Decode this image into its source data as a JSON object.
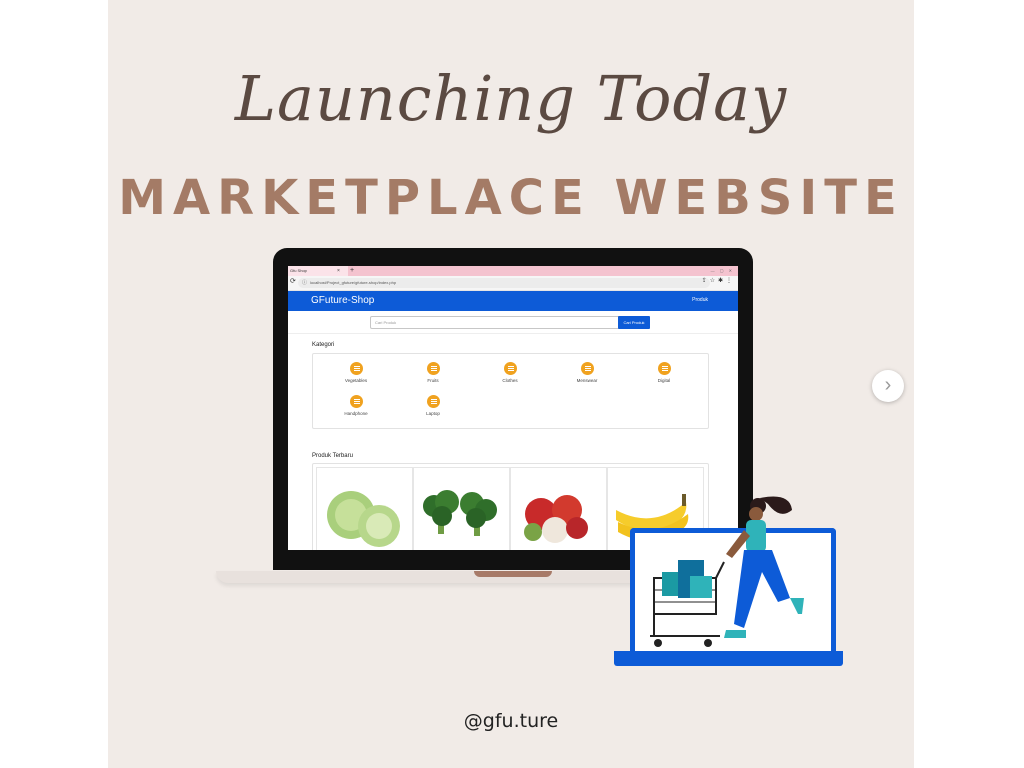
{
  "poster": {
    "script_title": "Launching Today",
    "main_title": "MARKETPLACE WEBSITE",
    "handle": "@gfu.ture"
  },
  "browser": {
    "tab_title": "Gfu Shop",
    "url": "localhost/Project_gfuture/gfuture-shop/index.php",
    "icons": [
      "reload-icon",
      "lock-icon",
      "share-icon",
      "star-icon",
      "extension-icon",
      "menu-icon"
    ]
  },
  "site": {
    "brand": "GFuture-Shop",
    "nav_link": "Produk",
    "search": {
      "placeholder": "Cari Produk",
      "button_label": "Cari Produk"
    },
    "kategori": {
      "title": "Kategori",
      "items": [
        {
          "label": "Vegetables",
          "icon": "list-icon"
        },
        {
          "label": "Fruits",
          "icon": "list-icon"
        },
        {
          "label": "Clothes",
          "icon": "list-icon"
        },
        {
          "label": "Menswear",
          "icon": "list-icon"
        },
        {
          "label": "Digital",
          "icon": "list-icon"
        },
        {
          "label": "Handphone",
          "icon": "list-icon"
        },
        {
          "label": "Laptop",
          "icon": "list-icon"
        }
      ]
    },
    "produk_terbaru": {
      "title": "Produk Terbaru",
      "items": [
        {
          "image": "cabbage"
        },
        {
          "image": "broccoli"
        },
        {
          "image": "rambutan"
        },
        {
          "image": "banana"
        }
      ]
    }
  },
  "colors": {
    "poster_background": "#f1ebe7",
    "title_brown": "#a47b66",
    "brand_blue": "#0d5bd7",
    "category_orange": "#f0a21f",
    "tab_pink": "#f4c3cf"
  },
  "carousel": {
    "next_icon": "chevron-right-icon"
  }
}
